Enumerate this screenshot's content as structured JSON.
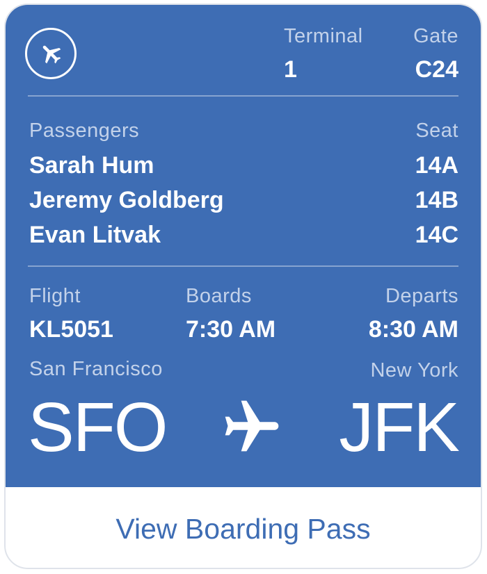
{
  "header": {
    "terminal_label": "Terminal",
    "terminal_value": "1",
    "gate_label": "Gate",
    "gate_value": "C24",
    "icon": "airplane-icon"
  },
  "passengers": {
    "label": "Passengers",
    "seat_label": "Seat",
    "list": [
      {
        "name": "Sarah Hum",
        "seat": "14A"
      },
      {
        "name": "Jeremy Goldberg",
        "seat": "14B"
      },
      {
        "name": "Evan Litvak",
        "seat": "14C"
      }
    ]
  },
  "flight": {
    "flight_label": "Flight",
    "flight_value": "KL5051",
    "boards_label": "Boards",
    "boards_value": "7:30 AM",
    "departs_label": "Departs",
    "departs_value": "8:30 AM"
  },
  "route": {
    "origin_city": "San Francisco",
    "origin_code": "SFO",
    "destination_city": "New York",
    "destination_code": "JFK",
    "icon": "airplane-icon"
  },
  "footer": {
    "button_label": "View Boarding Pass"
  },
  "colors": {
    "card_blue": "#3e6db4",
    "label_tint": "#c3d2ea",
    "link_blue": "#3e6db4"
  }
}
